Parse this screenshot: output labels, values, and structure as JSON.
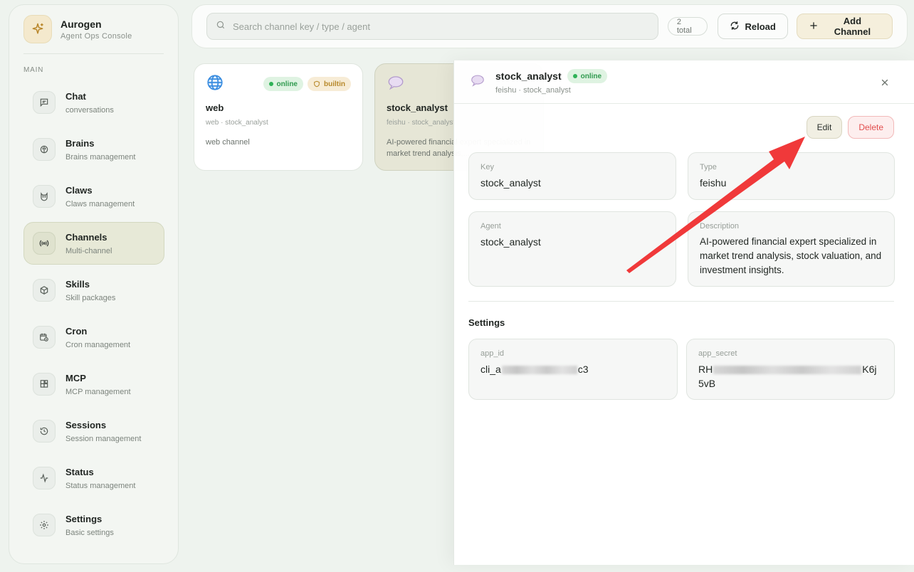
{
  "brand": {
    "title": "Aurogen",
    "subtitle": "Agent Ops Console"
  },
  "sidebar": {
    "section": "MAIN",
    "items": [
      {
        "label": "Chat",
        "sub": "conversations",
        "icon": "chat-icon"
      },
      {
        "label": "Brains",
        "sub": "Brains management",
        "icon": "brain-icon"
      },
      {
        "label": "Claws",
        "sub": "Claws management",
        "icon": "cat-icon"
      },
      {
        "label": "Channels",
        "sub": "Multi-channel",
        "icon": "broadcast-icon",
        "active": true
      },
      {
        "label": "Skills",
        "sub": "Skill packages",
        "icon": "package-icon"
      },
      {
        "label": "Cron",
        "sub": "Cron management",
        "icon": "calendar-clock-icon"
      },
      {
        "label": "MCP",
        "sub": "MCP management",
        "icon": "blocks-icon"
      },
      {
        "label": "Sessions",
        "sub": "Session management",
        "icon": "history-icon"
      },
      {
        "label": "Status",
        "sub": "Status management",
        "icon": "activity-icon"
      },
      {
        "label": "Settings",
        "sub": "Basic settings",
        "icon": "gear-icon"
      }
    ]
  },
  "toolbar": {
    "search_placeholder": "Search channel key / type / agent",
    "total": "2 total",
    "reload_label": "Reload",
    "add_label": "Add Channel"
  },
  "cards": [
    {
      "title": "web",
      "meta_type": "web",
      "meta_agent": "stock_analyst",
      "description": "web channel",
      "status": "online",
      "tag": "builtin",
      "icon": "globe-icon"
    },
    {
      "title": "stock_analyst",
      "meta_type": "feishu",
      "meta_agent": "stock_analyst",
      "description": "AI-powered financial expert specialized in market trend analysis,...",
      "icon": "speech-bubble-icon"
    }
  ],
  "panel": {
    "title": "stock_analyst",
    "status": "online",
    "sub_type": "feishu",
    "sub_agent": "stock_analyst",
    "edit_label": "Edit",
    "delete_label": "Delete",
    "fields": {
      "key_label": "Key",
      "key_value": "stock_analyst",
      "type_label": "Type",
      "type_value": "feishu",
      "agent_label": "Agent",
      "agent_value": "stock_analyst",
      "description_label": "Description",
      "description_value": "AI-powered financial expert specialized in market trend analysis, stock valuation, and investment insights."
    },
    "settings_title": "Settings",
    "settings": {
      "app_id_label": "app_id",
      "app_id_prefix": "cli_a",
      "app_id_suffix": "c3",
      "app_secret_label": "app_secret",
      "app_secret_prefix": "RH",
      "app_secret_suffix": "K6j",
      "app_secret_line2": "5vB"
    }
  },
  "colors": {
    "accent": "#f5efdc",
    "online": "#2fb257",
    "danger": "#e24d4d",
    "arrow": "#f0393a"
  }
}
